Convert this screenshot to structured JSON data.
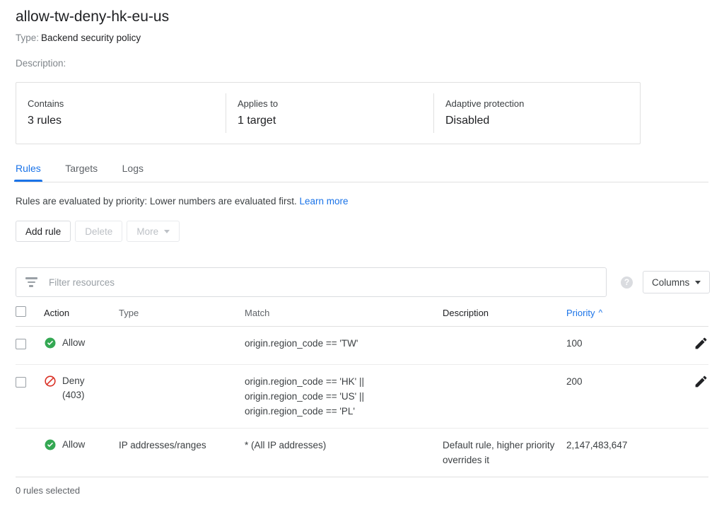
{
  "header": {
    "title": "allow-tw-deny-hk-eu-us",
    "type_label": "Type:",
    "type_value": "Backend security policy",
    "description_label": "Description:"
  },
  "summary": {
    "cells": [
      {
        "label": "Contains",
        "value": "3 rules"
      },
      {
        "label": "Applies to",
        "value": "1 target"
      },
      {
        "label": "Adaptive protection",
        "value": "Disabled"
      }
    ]
  },
  "tabs": [
    {
      "label": "Rules",
      "active": true
    },
    {
      "label": "Targets",
      "active": false
    },
    {
      "label": "Logs",
      "active": false
    }
  ],
  "hint": {
    "text": "Rules are evaluated by priority: Lower numbers are evaluated first.",
    "link": "Learn more"
  },
  "toolbar": {
    "add_rule": "Add rule",
    "delete": "Delete",
    "more": "More"
  },
  "filter": {
    "placeholder": "Filter resources",
    "value": "",
    "help_glyph": "?",
    "columns_label": "Columns"
  },
  "table": {
    "columns": [
      {
        "key": "action",
        "label": "Action",
        "style": "strong"
      },
      {
        "key": "type",
        "label": "Type",
        "style": "muted"
      },
      {
        "key": "match",
        "label": "Match",
        "style": "muted"
      },
      {
        "key": "description",
        "label": "Description",
        "style": "strong"
      },
      {
        "key": "priority",
        "label": "Priority",
        "style": "sorted",
        "sort": "ascending",
        "sort_glyph": "^"
      }
    ],
    "rows": [
      {
        "selectable": true,
        "selected": false,
        "action": "Allow",
        "action_icon": "allow-check-circle-icon",
        "action_sub": "",
        "type": "",
        "match": [
          "origin.region_code == 'TW'"
        ],
        "description": "",
        "priority": "100",
        "editable": true
      },
      {
        "selectable": true,
        "selected": false,
        "action": "Deny",
        "action_icon": "deny-block-icon",
        "action_sub": "(403)",
        "type": "",
        "match": [
          "origin.region_code == 'HK' ||",
          "origin.region_code == 'US' ||",
          "origin.region_code == 'PL'"
        ],
        "description": "",
        "priority": "200",
        "editable": true
      },
      {
        "selectable": false,
        "selected": false,
        "action": "Allow",
        "action_icon": "allow-check-circle-icon",
        "action_sub": "",
        "type": "IP addresses/ranges",
        "match": [
          "* (All IP addresses)"
        ],
        "description": "Default rule, higher priority overrides it",
        "priority": "2,147,483,647",
        "editable": false
      }
    ]
  },
  "footer": {
    "selection_status": "0 rules selected"
  },
  "colors": {
    "accent_blue": "#1a73e8",
    "allow_green": "#34a853",
    "deny_red": "#d93025",
    "text_primary": "#202124",
    "text_secondary": "#5f6368",
    "border": "#e0e0e0"
  }
}
